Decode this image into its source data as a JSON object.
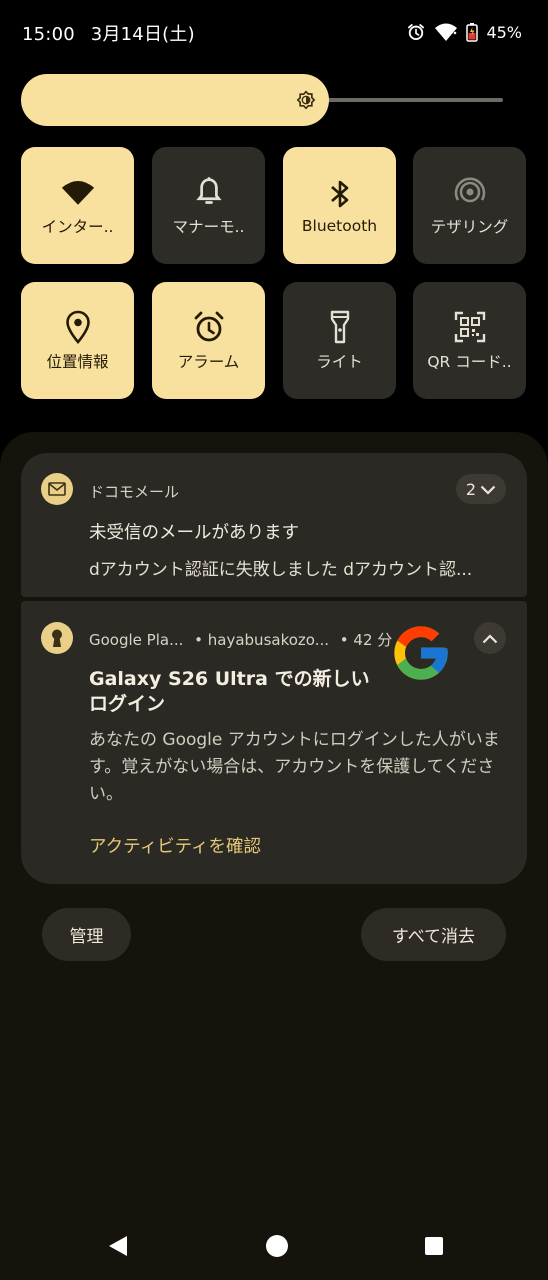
{
  "status_bar": {
    "time": "15:00",
    "date": "3月14日(土)",
    "battery": "45%"
  },
  "brightness": {
    "level": 0.64
  },
  "tiles": [
    {
      "label": "インター..",
      "on": true,
      "icon": "wifi-icon"
    },
    {
      "label": "マナーモ..",
      "on": false,
      "icon": "bell-icon"
    },
    {
      "label": "Bluetooth",
      "on": true,
      "icon": "bluetooth-icon"
    },
    {
      "label": "テザリング",
      "on": false,
      "icon": "hotspot-icon"
    },
    {
      "label": "位置情報",
      "on": true,
      "icon": "location-icon"
    },
    {
      "label": "アラーム",
      "on": true,
      "icon": "alarm-icon"
    },
    {
      "label": "ライト",
      "on": false,
      "icon": "flashlight-icon"
    },
    {
      "label": "QR コード..",
      "on": false,
      "icon": "qr-code-icon"
    }
  ],
  "notifications": [
    {
      "app": "ドコモメール",
      "count": "2",
      "title": "未受信のメールがあります",
      "text": "dアカウント認証に失敗しました dアカウント認..."
    },
    {
      "app": "Google Pla...",
      "account": "• hayabusakozo...",
      "time": "• 42 分",
      "title": "Galaxy S26 Ultra での新しいログイン",
      "body": "あなたの Google アカウントにログインした人がいます。覚えがない場合は、アカウントを保護してください。",
      "action": "アクティビティを確認"
    }
  ],
  "buttons": {
    "manage": "管理",
    "clear_all": "すべて消去"
  },
  "colors": {
    "accent": "#f8e19e",
    "tile_off": "#2e2c27",
    "card": "#2b2924",
    "link": "#e5c977"
  }
}
